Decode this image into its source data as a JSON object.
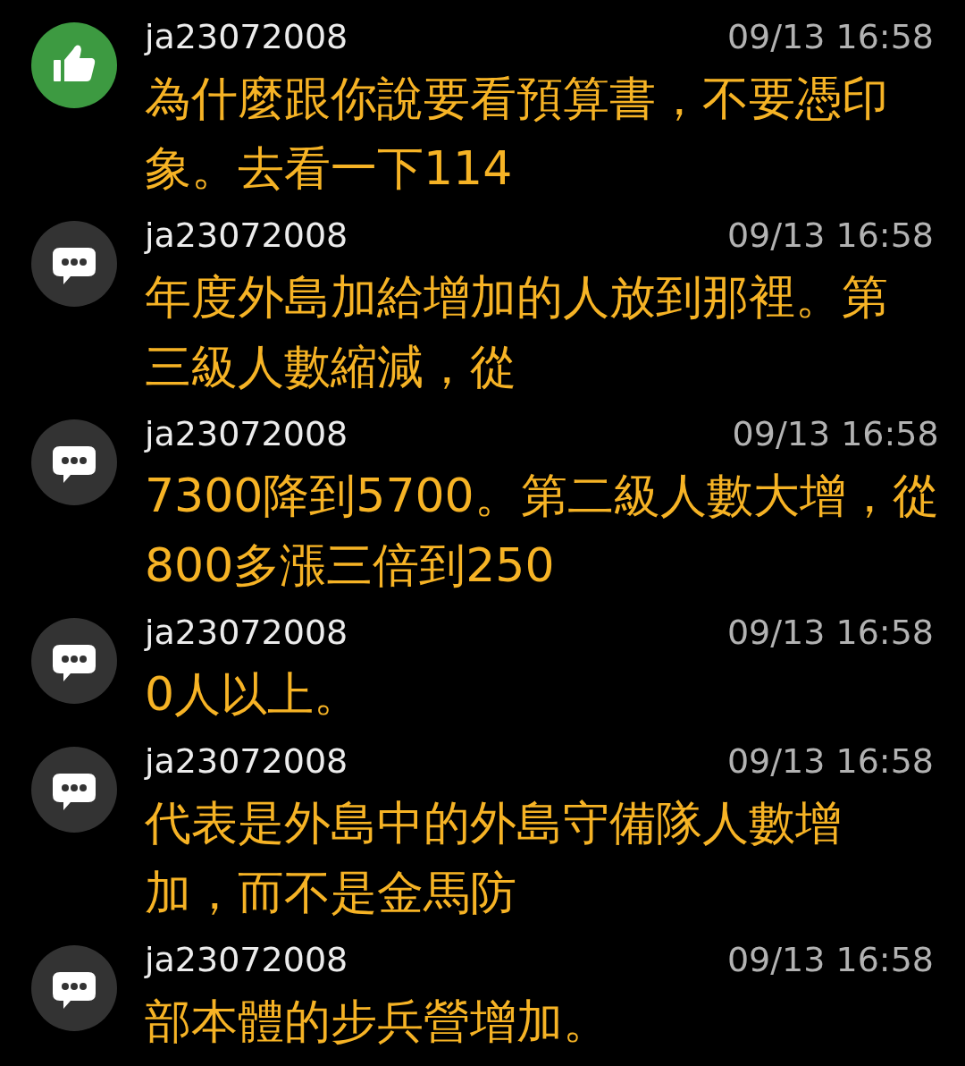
{
  "comments": [
    {
      "kind": "like",
      "user": "ja23072008",
      "time": "09/13 16:58",
      "lines": [
        "為什麼跟你說要看預算書，不要憑印",
        "象。去看一下114"
      ]
    },
    {
      "kind": "comment",
      "user": "ja23072008",
      "time": "09/13 16:58",
      "lines": [
        "年度外島加給增加的人放到那裡。第",
        "三級人數縮減，從"
      ]
    },
    {
      "kind": "comment",
      "user": "ja23072008",
      "time": "09/13 16:58",
      "lines": [
        "7300降到5700。第二級人數大增，從",
        "800多漲三倍到250"
      ]
    },
    {
      "kind": "comment",
      "user": "ja23072008",
      "time": "09/13 16:58",
      "lines": [
        "0人以上。"
      ]
    },
    {
      "kind": "comment",
      "user": "ja23072008",
      "time": "09/13 16:58",
      "lines": [
        "代表是外島中的外島守備隊人數增",
        "加，而不是金馬防"
      ]
    },
    {
      "kind": "comment",
      "user": "ja23072008",
      "time": "09/13 16:58",
      "lines": [
        "部本體的步兵營增加。"
      ]
    }
  ]
}
